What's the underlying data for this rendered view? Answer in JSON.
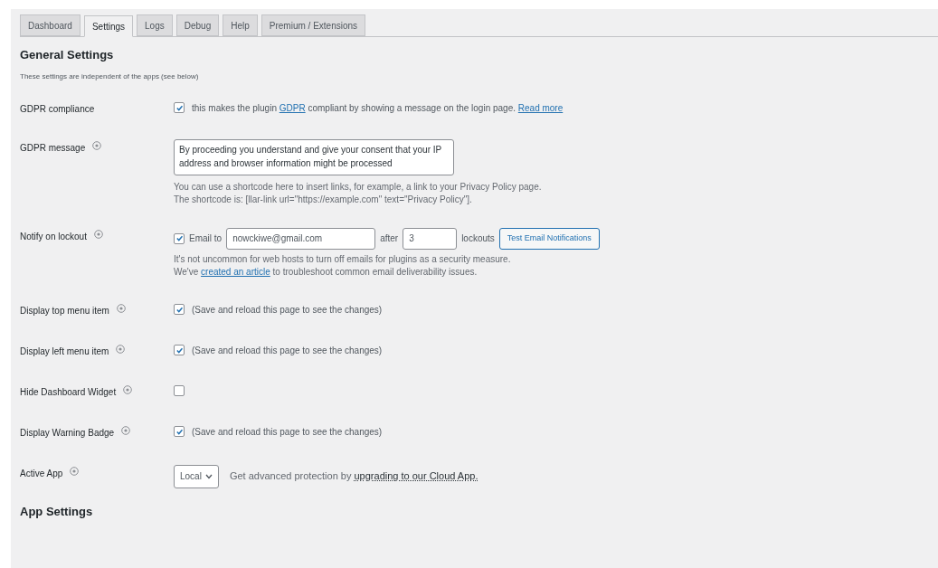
{
  "tabs": [
    {
      "label": "Dashboard",
      "selected": false
    },
    {
      "label": "Settings",
      "selected": true
    },
    {
      "label": "Logs",
      "selected": false
    },
    {
      "label": "Debug",
      "selected": false
    },
    {
      "label": "Help",
      "selected": false
    },
    {
      "label": "Premium / Extensions",
      "selected": false
    }
  ],
  "heading": "General Settings",
  "description": "These settings are independent of the apps (see below)",
  "rows": [
    {
      "kind": "gdpr",
      "label": "GDPR compliance",
      "help": false,
      "checked": true,
      "before": "this makes the plugin",
      "link": "GDPR",
      "after": "compliant by showing a message on the login page.",
      "more": "Read more"
    },
    {
      "kind": "textarea",
      "label": "GDPR message",
      "help": true,
      "value": "By proceeding you understand and give your consent that your IP address and browser information might be processed",
      "notes": [
        "You can use a shortcode here to insert links, for example, a link to your Privacy Policy page.",
        "The shortcode is: [llar-link url=\"https://example.com\" text=\"Privacy Policy\"]."
      ]
    },
    {
      "kind": "notify",
      "label": "Notify on lockout",
      "help": true,
      "checked": true,
      "email_label": "Email to",
      "email": "nowckiwe@gmail.com",
      "after_label": "after",
      "count": "3",
      "lockouts_label": "lockouts",
      "button": "Test Email Notifications",
      "note": "It's not uncommon for web hosts to turn off emails for plugins as a security measure.",
      "note2_before": "We've",
      "note2_link": "created an article",
      "note2_after": "to troubleshoot common email deliverability issues."
    },
    {
      "kind": "checkbox",
      "label": "Display top menu item",
      "help": true,
      "checked": true,
      "text": "(Save and reload this page to see the changes)"
    },
    {
      "kind": "checkbox",
      "label": "Display left menu item",
      "help": true,
      "checked": true,
      "text": "(Save and reload this page to see the changes)"
    },
    {
      "kind": "checkbox",
      "label": "Hide Dashboard Widget",
      "help": true,
      "checked": false
    },
    {
      "kind": "checkbox",
      "label": "Display Warning Badge",
      "help": true,
      "checked": true,
      "text": "(Save and reload this page to see the changes)"
    },
    {
      "kind": "select",
      "label": "Active App",
      "help": true,
      "value": "Local",
      "text": "Get advanced protection by",
      "link": "upgrading to our Cloud App."
    }
  ],
  "next_heading": "App Settings"
}
